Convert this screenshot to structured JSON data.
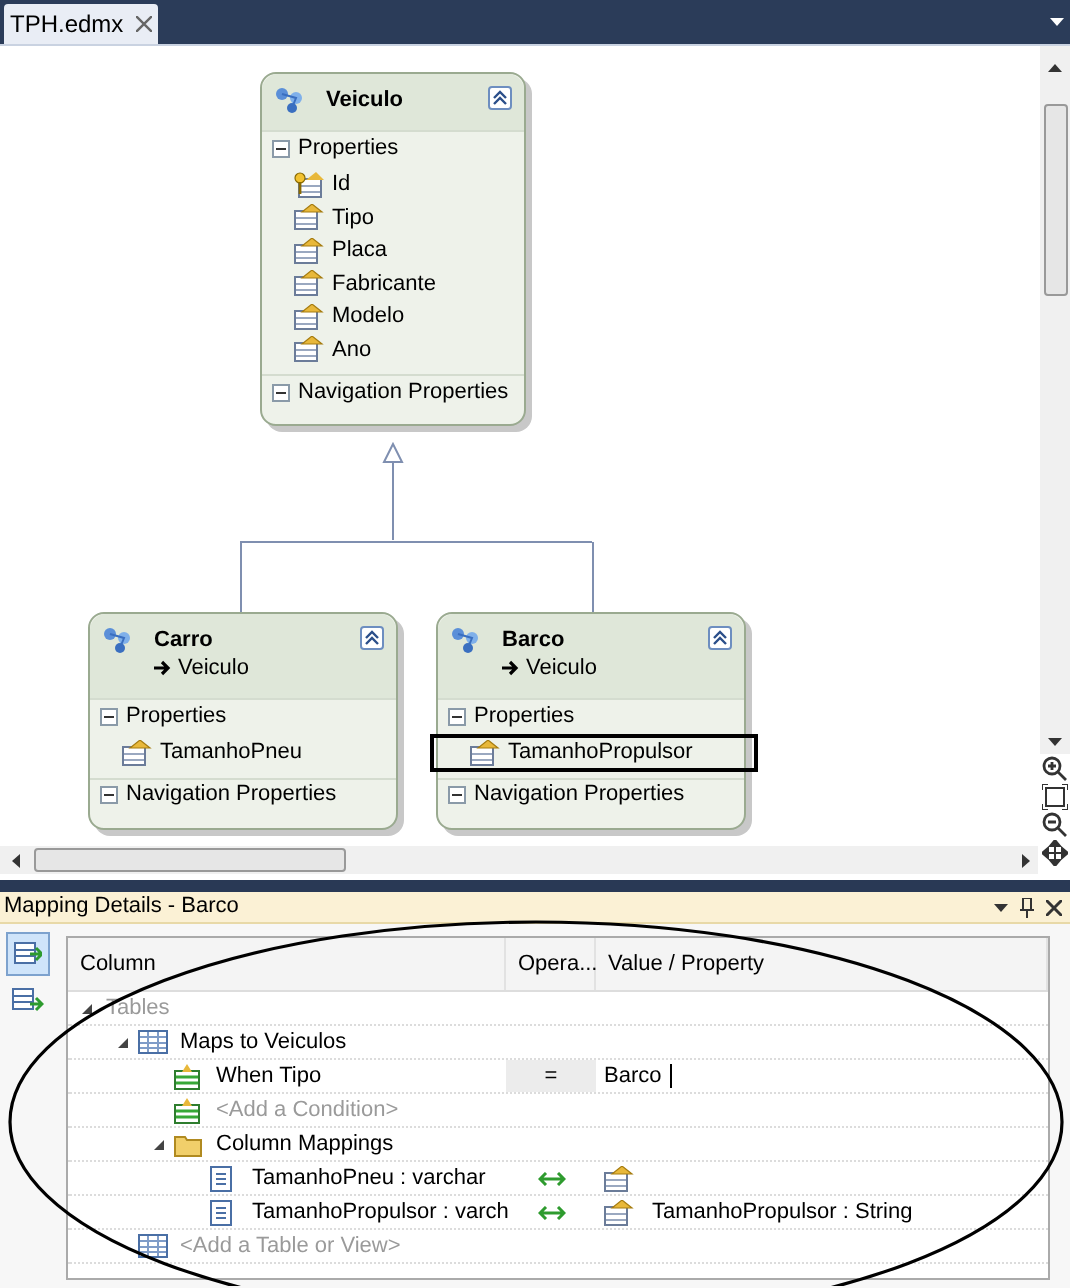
{
  "tab": {
    "label": "TPH.edmx",
    "selected": true
  },
  "entities": [
    {
      "name": "Veiculo",
      "sections": [
        {
          "label": "Properties",
          "expanded": true,
          "items": [
            {
              "name": "Id",
              "key": true,
              "highlighted": false
            },
            {
              "name": "Tipo",
              "key": false,
              "highlighted": false
            },
            {
              "name": "Placa",
              "key": false,
              "highlighted": false
            },
            {
              "name": "Fabricante",
              "key": false,
              "highlighted": false
            },
            {
              "name": "Modelo",
              "key": false,
              "highlighted": false
            },
            {
              "name": "Ano",
              "key": false,
              "highlighted": false
            }
          ]
        },
        {
          "label": "Navigation Properties",
          "expanded": true
        }
      ]
    },
    {
      "name": "Carro",
      "base": "Veiculo",
      "sections": [
        {
          "label": "Properties",
          "expanded": true,
          "items": [
            {
              "name": "TamanhoPneu",
              "key": false,
              "highlighted": false
            }
          ]
        },
        {
          "label": "Navigation Properties",
          "expanded": true
        }
      ]
    },
    {
      "name": "Barco",
      "base": "Veiculo",
      "sections": [
        {
          "label": "Properties",
          "expanded": true,
          "items": [
            {
              "name": "TamanhoPropulsor",
              "key": false,
              "highlighted": true
            }
          ]
        },
        {
          "label": "Navigation Properties",
          "expanded": true
        }
      ]
    }
  ],
  "mapping": {
    "title": "Mapping Details - Barco",
    "columns": [
      "Column",
      "Opera...",
      "Value / Property"
    ],
    "rows": [
      {
        "kind": "group",
        "label": "Tables",
        "expanded": true,
        "children": [
          {
            "kind": "table",
            "label": "Maps to Veiculos",
            "expanded": true,
            "children": [
              {
                "kind": "condition",
                "label": "When Tipo",
                "operator": "=",
                "value": "Barco"
              },
              {
                "kind": "add-condition",
                "label": "<Add a Condition>"
              },
              {
                "kind": "folder",
                "label": "Column Mappings",
                "expanded": true,
                "children": [
                  {
                    "kind": "mapping",
                    "label": "TamanhoPneu : varchar"
                  },
                  {
                    "kind": "mapping",
                    "label": "TamanhoPropulsor : varch",
                    "value": "TamanhoPropulsor : String"
                  }
                ]
              }
            ]
          },
          {
            "kind": "add-table",
            "label": "<Add a Table or View>"
          }
        ]
      }
    ]
  }
}
